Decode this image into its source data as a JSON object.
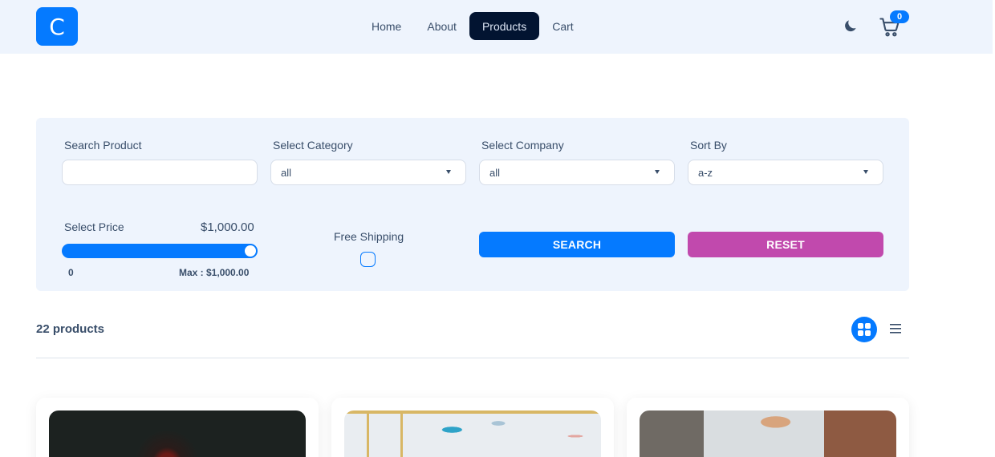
{
  "navbar": {
    "logo_letter": "C",
    "links": [
      "Home",
      "About",
      "Products",
      "Cart"
    ],
    "active_link": "Products",
    "cart_count": "0"
  },
  "filters": {
    "search": {
      "label": "Search Product",
      "value": ""
    },
    "category": {
      "label": "Select Category",
      "value": "all"
    },
    "company": {
      "label": "Select Company",
      "value": "all"
    },
    "sort": {
      "label": "Sort By",
      "value": "a-z"
    },
    "price": {
      "label": "Select Price",
      "display": "$1,000.00",
      "min_label": "0",
      "max_label": "Max : $1,000.00",
      "fraction": 1.0
    },
    "shipping": {
      "label": "Free Shipping",
      "checked": false
    },
    "search_button": "SEARCH",
    "reset_button": "RESET"
  },
  "products": {
    "count_label": "22 products",
    "layout": "grid"
  },
  "colors": {
    "primary": "#057aff",
    "secondary": "#c149ad",
    "navbar_bg": "#eef4fd",
    "active_nav": "#021431"
  }
}
